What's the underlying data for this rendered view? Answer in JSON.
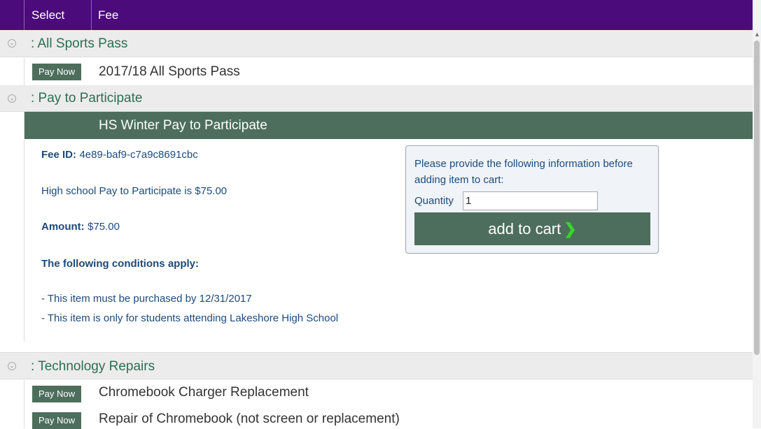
{
  "header": {
    "select_label": "Select",
    "fee_label": "Fee"
  },
  "groups": [
    {
      "title": ": All Sports Pass",
      "items": [
        {
          "button": "Pay Now",
          "name": "2017/18 All Sports Pass"
        }
      ]
    },
    {
      "title": ": Pay to Participate",
      "expanded": {
        "title": "HS Winter Pay to Participate",
        "fee_id_label": "Fee ID:",
        "fee_id": "4e89-baf9-c7a9c8691cbc",
        "description": "High school Pay to Participate is $75.00",
        "amount_label": "Amount:",
        "amount": "$75.00",
        "conditions_label": "The following conditions apply:",
        "conditions": [
          "- This item must be purchased by 12/31/2017",
          "- This item is only for students attending Lakeshore High School"
        ],
        "info_message": "Please provide the following information before adding item to cart:",
        "quantity_label": "Quantity",
        "quantity_value": "1",
        "add_to_cart_label": "add to cart",
        "add_to_cart_arrow": "❯"
      }
    },
    {
      "title": ": Technology Repairs",
      "items": [
        {
          "button": "Pay Now",
          "name": "Chromebook Charger Replacement"
        },
        {
          "button": "Pay Now",
          "name": "Repair of Chromebook (not screen or replacement)"
        }
      ]
    }
  ],
  "icons": {
    "expander": "collapse-circle-icon",
    "arrow": "chevron-right-icon"
  },
  "colors": {
    "header_bg": "#4b0b7b",
    "accent_green": "#4d6e5c",
    "group_title": "#2d6e52",
    "text_blue": "#1d4a7a"
  }
}
